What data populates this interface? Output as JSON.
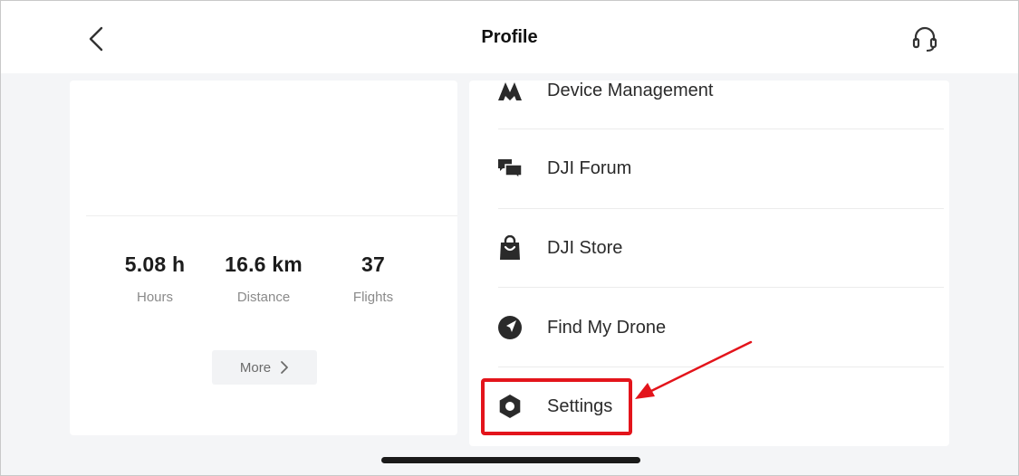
{
  "header": {
    "title": "Profile",
    "back_icon": "chevron-left-icon",
    "support_icon": "headset-icon"
  },
  "stats": {
    "hours": {
      "value": "5.08 h",
      "label": "Hours"
    },
    "distance": {
      "value": "16.6 km",
      "label": "Distance"
    },
    "flights": {
      "value": "37",
      "label": "Flights"
    },
    "more_label": "More"
  },
  "menu": {
    "items": [
      {
        "label": "Device Management",
        "icon": "drone-arrow-icon"
      },
      {
        "label": "DJI Forum",
        "icon": "chat-bubbles-icon"
      },
      {
        "label": "DJI Store",
        "icon": "shopping-bag-icon"
      },
      {
        "label": "Find My Drone",
        "icon": "locate-icon"
      },
      {
        "label": "Settings",
        "icon": "hexagon-gear-icon"
      }
    ]
  },
  "annotation": {
    "highlight_color": "#e3141b"
  }
}
